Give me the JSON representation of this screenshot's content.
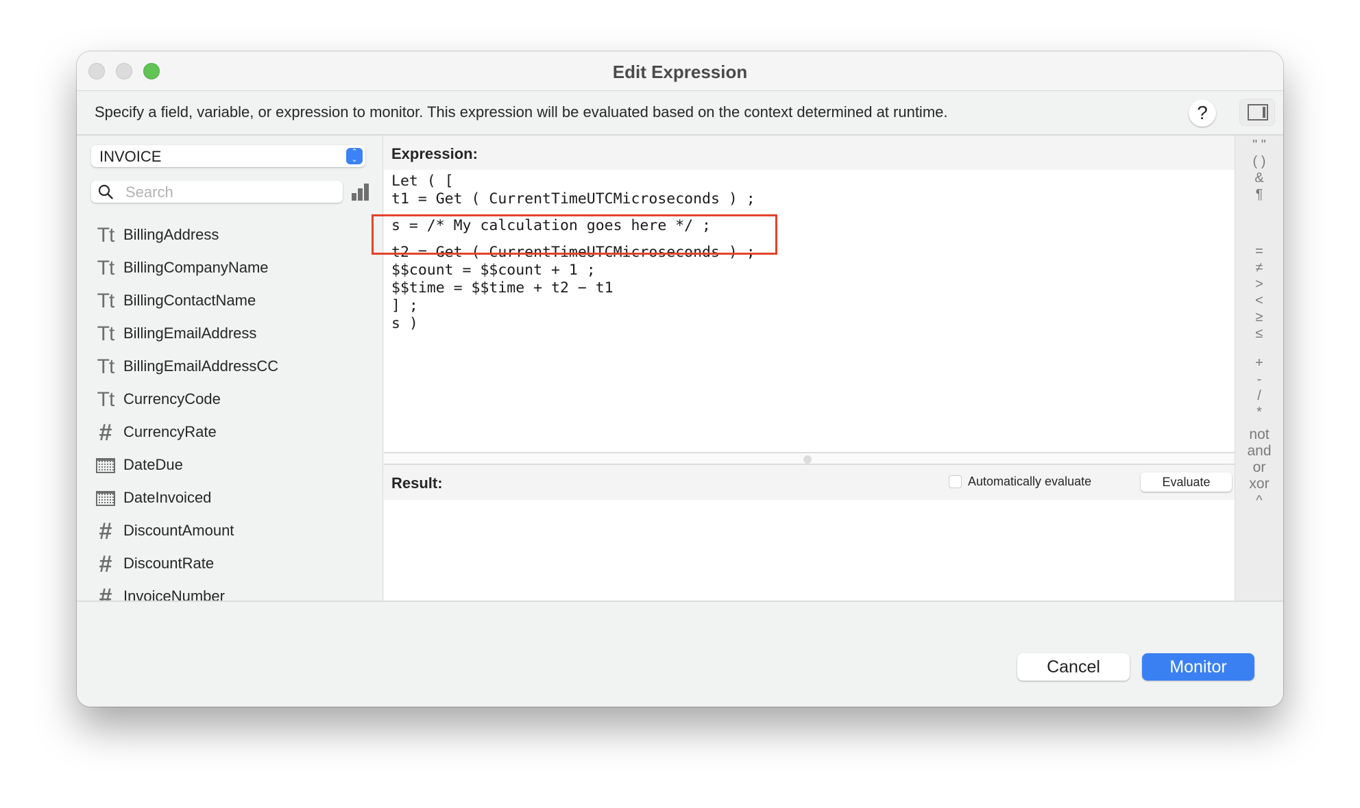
{
  "window": {
    "title": "Edit Expression",
    "description": "Specify a field, variable, or expression to monitor. This expression will be evaluated based on the context determined at runtime.",
    "help_label": "?"
  },
  "left_panel": {
    "table_selector": "INVOICE",
    "search_placeholder": "Search",
    "search_value": "",
    "fields": [
      {
        "name": "BillingAddress",
        "type": "text",
        "icon": "Tt"
      },
      {
        "name": "BillingCompanyName",
        "type": "text",
        "icon": "Tt"
      },
      {
        "name": "BillingContactName",
        "type": "text",
        "icon": "Tt"
      },
      {
        "name": "BillingEmailAddress",
        "type": "text",
        "icon": "Tt"
      },
      {
        "name": "BillingEmailAddressCC",
        "type": "text",
        "icon": "Tt"
      },
      {
        "name": "CurrencyCode",
        "type": "text",
        "icon": "Tt"
      },
      {
        "name": "CurrencyRate",
        "type": "number",
        "icon": "#"
      },
      {
        "name": "DateDue",
        "type": "date",
        "icon": ""
      },
      {
        "name": "DateInvoiced",
        "type": "date",
        "icon": ""
      },
      {
        "name": "DiscountAmount",
        "type": "number",
        "icon": "#"
      },
      {
        "name": "DiscountRate",
        "type": "number",
        "icon": "#"
      },
      {
        "name": "InvoiceNumber",
        "type": "number",
        "icon": "#"
      }
    ]
  },
  "editor": {
    "expression_label": "Expression:",
    "code_before": "Let ( [\nt1 = Get ( CurrentTimeUTCMicroseconds ) ;",
    "code_highlighted": "s = /* My calculation goes here */ ;",
    "code_after": "t2 = Get ( CurrentTimeUTCMicroseconds ) ;\n$$count = $$count + 1 ;\n$$time = $$time + t2 − t1\n] ;\ns )",
    "highlight_color": "#e2432a",
    "result_label": "Result:",
    "auto_evaluate_label": "Automatically evaluate",
    "auto_evaluate_checked": false,
    "evaluate_button": "Evaluate",
    "result_value": ""
  },
  "operators": {
    "group1": [
      "\" \"",
      "( )",
      "&",
      "¶"
    ],
    "group2": [
      "=",
      "≠",
      ">",
      "<",
      "≥",
      "≤"
    ],
    "group3": [
      "+",
      "-",
      "/",
      "*"
    ],
    "group4": [
      "not",
      "and",
      "or",
      "xor",
      "^"
    ]
  },
  "footer": {
    "cancel_label": "Cancel",
    "monitor_label": "Monitor",
    "accent_color": "#3b80f3"
  }
}
